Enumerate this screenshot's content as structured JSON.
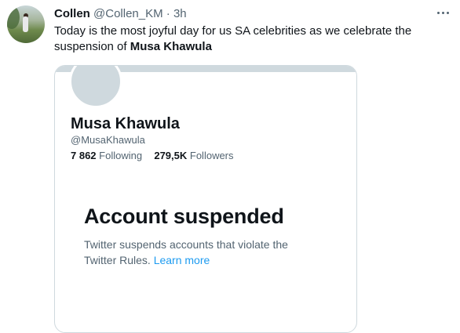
{
  "tweet": {
    "author_name": "Collen",
    "author_handle": "@Collen_KM",
    "separator": "·",
    "time": "3h",
    "text_main": "Today is the most joyful day for us SA celebrities as we celebrate the suspension of ",
    "text_bold": "Musa Khawula"
  },
  "embedded_profile": {
    "name": "Musa Khawula",
    "handle": "@MusaKhawula",
    "following_count": "7 862",
    "following_label": "Following",
    "followers_count": "279,5K",
    "followers_label": "Followers",
    "suspended_title": "Account suspended",
    "suspended_text": "Twitter suspends accounts that violate the Twitter Rules.",
    "learn_more": "Learn more"
  },
  "icons": {
    "more": "more-options-icon",
    "avatar": "user-avatar"
  },
  "colors": {
    "text_primary": "#0f1419",
    "text_secondary": "#536471",
    "link": "#1d9bf0",
    "border": "#cfd9de"
  }
}
